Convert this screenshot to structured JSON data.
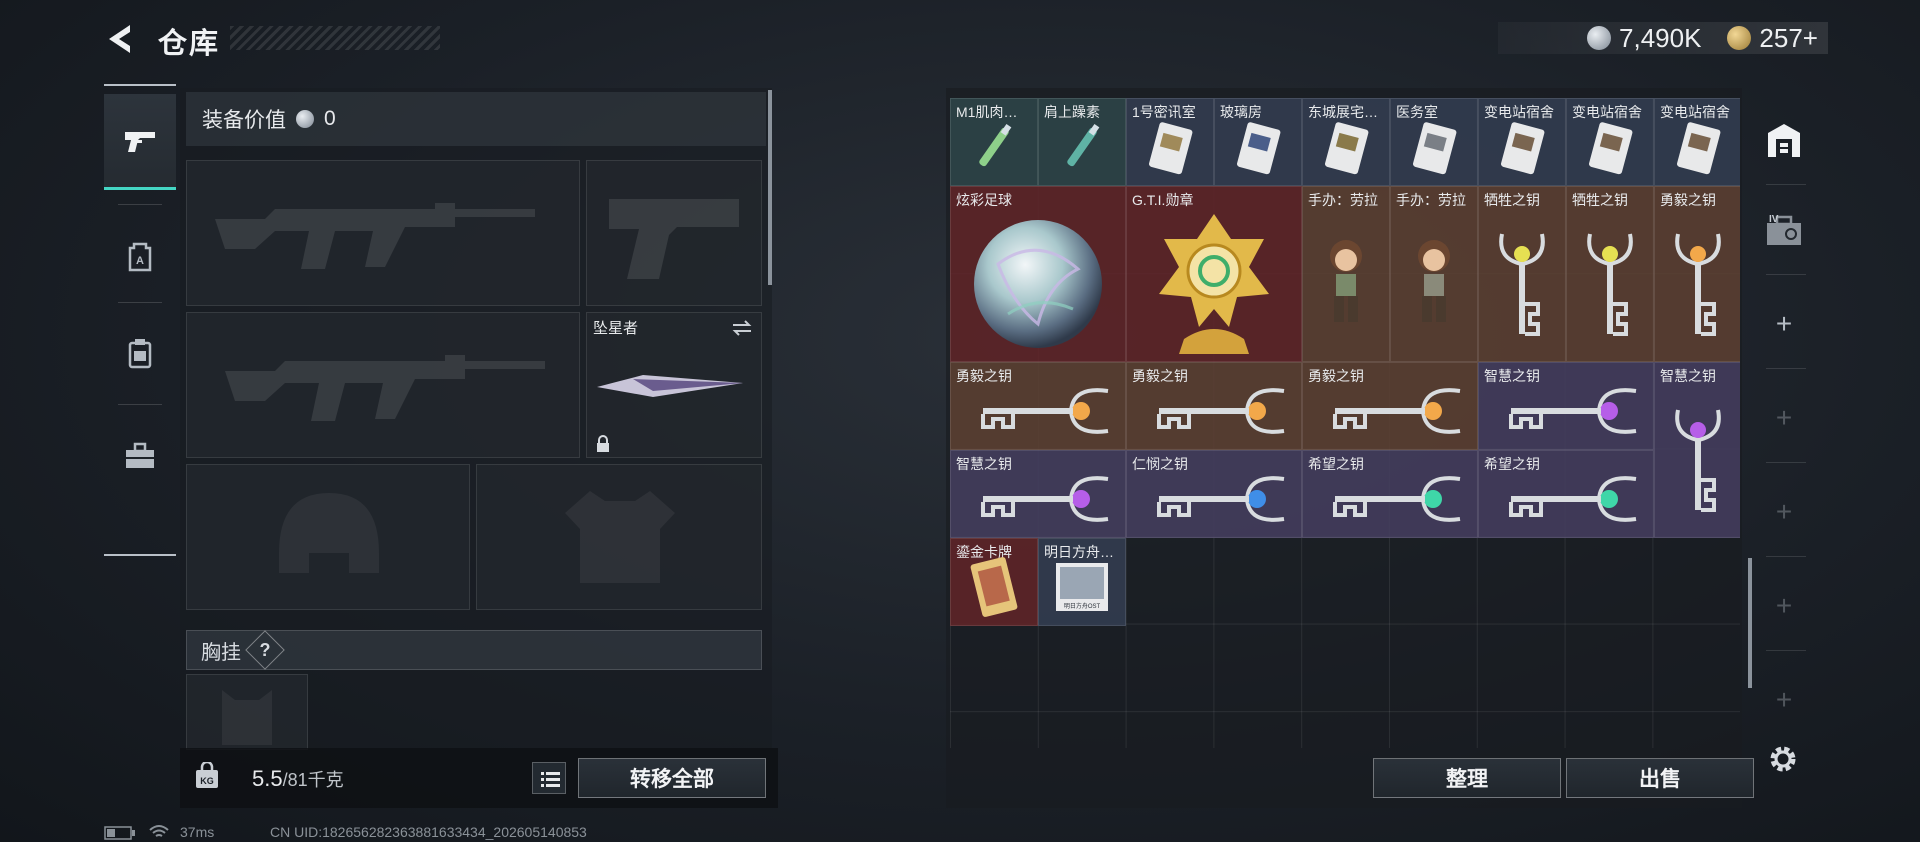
{
  "header": {
    "title": "仓库",
    "currency": [
      {
        "icon": "silver-coin-icon",
        "value": "7,490K"
      },
      {
        "icon": "gold-coin-icon",
        "value": "257+"
      }
    ]
  },
  "left_nav": {
    "items": [
      {
        "icon": "pistol-icon",
        "active": true
      },
      {
        "icon": "backpack-icon",
        "active": false
      },
      {
        "icon": "armor-plate-icon",
        "active": false
      },
      {
        "icon": "toolbox-icon",
        "active": false
      }
    ]
  },
  "equipment": {
    "value_label": "装备价值",
    "value": "0",
    "melee_name": "坠星者",
    "vest_label": "胸挂",
    "vest_help": "?",
    "weight_value": "5.5",
    "weight_max": "/81千克",
    "transfer_all_label": "转移全部"
  },
  "warehouse": {
    "row1": [
      "M1肌肉…",
      "肩上躁素",
      "1号密讯室",
      "玻璃房",
      "东城展宅…",
      "医务室",
      "变电站宿舍",
      "变电站宿舍",
      "变电站宿舍"
    ],
    "big_items": [
      "炫彩足球",
      "G.T.I.勋章"
    ],
    "row2": [
      "手办：劳拉",
      "手办：劳拉",
      "牺牲之钥",
      "牺牲之钥",
      "勇毅之钥"
    ],
    "row3": [
      "勇毅之钥",
      "勇毅之钥",
      "勇毅之钥",
      "智慧之钥",
      "智慧之钥"
    ],
    "row4": [
      "智慧之钥",
      "仁悯之钥",
      "希望之钥",
      "希望之钥"
    ],
    "row5": [
      "鎏金卡牌",
      "明日方舟…"
    ],
    "card_text": "明日方舟OST",
    "sort_label": "整理",
    "sell_label": "出售"
  },
  "right_nav": {
    "items": [
      "warehouse-icon",
      "tier4-case-icon",
      "add-icon",
      "add-icon",
      "add-icon",
      "add-icon",
      "add-icon"
    ],
    "add_symbol": "+",
    "tier_label": "IV"
  },
  "status_bar": {
    "ping": "37ms",
    "uid": "CN UID:1826562823638816334​34_202605140853"
  },
  "colors": {
    "accent": "#44d6c4",
    "rarity_red": "#602428",
    "rarity_purple": "#443e5e",
    "rarity_brown": "#5c4032",
    "rarity_green": "#2e464a"
  }
}
